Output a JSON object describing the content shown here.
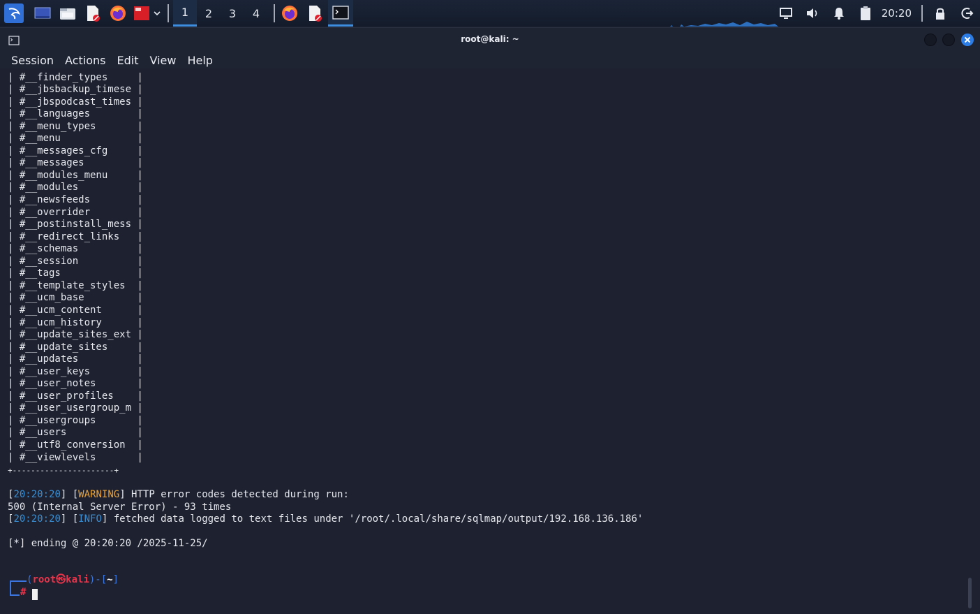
{
  "taskbar": {
    "workspaces": [
      "1",
      "2",
      "3",
      "4"
    ],
    "active_workspace": 0,
    "clock": "20:20",
    "icons": {
      "launcher": "kali-dragon-icon",
      "desktop": "show-desktop-icon",
      "files": "file-manager-icon",
      "editor": "text-editor-icon",
      "browser": "firefox-icon",
      "terminal_app": "terminal-emulator-icon"
    }
  },
  "window": {
    "title": "root@kali: ~"
  },
  "menu": [
    "Session",
    "Actions",
    "Edit",
    "View",
    "Help"
  ],
  "table_rows": [
    "#__finder_types",
    "#__jbsbackup_timese",
    "#__jbspodcast_times",
    "#__languages",
    "#__menu_types",
    "#__menu",
    "#__messages_cfg",
    "#__messages",
    "#__modules_menu",
    "#__modules",
    "#__newsfeeds",
    "#__overrider",
    "#__postinstall_mess",
    "#__redirect_links",
    "#__schemas",
    "#__session",
    "#__tags",
    "#__template_styles",
    "#__ucm_base",
    "#__ucm_content",
    "#__ucm_history",
    "#__update_sites_ext",
    "#__update_sites",
    "#__updates",
    "#__user_keys",
    "#__user_notes",
    "#__user_profiles",
    "#__user_usergroup_m",
    "#__usergroups",
    "#__users",
    "#__utf8_conversion",
    "#__viewlevels"
  ],
  "table_border": "+----------------------+",
  "log": {
    "warn_time": "20:20:20",
    "warn_tag": "WARNING",
    "warn_msg": " HTTP error codes detected during run:",
    "error_line": "500 (Internal Server Error) - 93 times",
    "info_time": "20:20:20",
    "info_tag": "INFO",
    "info_msg": " fetched data logged to text files under '/root/.local/share/sqlmap/output/192.168.136.186'",
    "ending": "[*] ending @ 20:20:20 /2025-11-25/"
  },
  "prompt": {
    "user": "root",
    "at": "㉿",
    "host": "kali",
    "path": "~",
    "symbol": "#"
  }
}
